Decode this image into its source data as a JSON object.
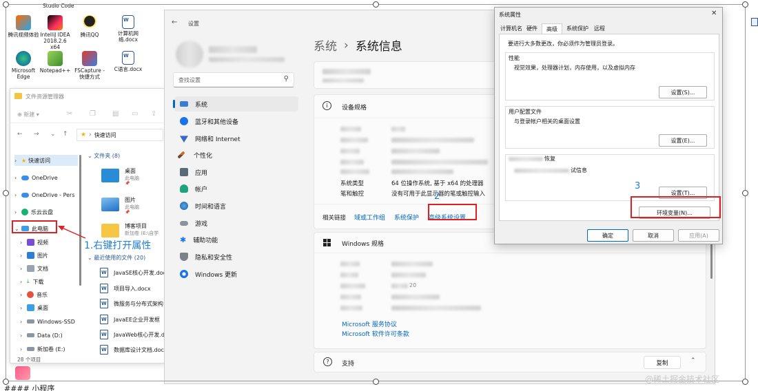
{
  "desktop": {
    "top_label": "Studio Code",
    "icons": [
      {
        "label": "腾讯视频体验"
      },
      {
        "label": "IntelliJ IDEA 2018.2.6 x64"
      },
      {
        "label": "腾讯QQ"
      },
      {
        "label": "计算机网络.docx"
      },
      {
        "label": "Microsoft Edge"
      },
      {
        "label": "Notepad++"
      },
      {
        "label": "FSCapture - 快捷方式"
      },
      {
        "label": "C语言.docx"
      }
    ],
    "bottom_label": "#### 小程序"
  },
  "explorer": {
    "title": "文件资源管理器",
    "new_label": "新建",
    "address": "快速访问",
    "tree": [
      "快速访问",
      "OneDrive",
      "OneDrive - Pers",
      "乐云云盘",
      "此电脑",
      "视频",
      "图片",
      "文档",
      "下载",
      "音乐",
      "桌面",
      "Windows-SSD",
      "Data (D:)",
      "新加卷 (E:)"
    ],
    "folders_header": "文件夹 (8)",
    "folders": [
      {
        "name": "桌面",
        "sub": "此电脑"
      },
      {
        "name": "图片",
        "sub": "此电脑"
      },
      {
        "name": "博客项目",
        "sub": "新加卷 (E:\\自学"
      }
    ],
    "recent_header": "最近使用的文件 (20)",
    "recent": [
      "JavaSE核心开发.doc",
      "项目导入.docx",
      "微服务与分布式架构",
      "JavaEE企业开发框",
      "JavaWeb核心开发.d",
      "数据库设计文档.doc"
    ],
    "status": "28 个项目"
  },
  "settings": {
    "title": "设置",
    "search_placeholder": "查找设置",
    "breadcrumb_parent": "系统",
    "breadcrumb_sep": "›",
    "breadcrumb_current": "系统信息",
    "nav": [
      "系统",
      "蓝牙和其他设备",
      "网络和 Internet",
      "个性化",
      "应用",
      "帐户",
      "时间和语言",
      "游戏",
      "辅助功能",
      "隐私和安全性",
      "Windows 更新"
    ],
    "device_specs_title": "设备规格",
    "system_type_label": "系统类型",
    "system_type_value": "64 位操作系统, 基于 x64 的处理器",
    "pen_label": "笔和触控",
    "pen_value": "没有可用于此显示器的笔或触控输入",
    "related_label": "相关链接",
    "related_links": [
      "域或工作组",
      "系统保护",
      "高级系统设置"
    ],
    "windows_specs_title": "Windows 规格",
    "version_fragment": "20",
    "ms_links": [
      "Microsoft 服务协议",
      "Microsoft 软件许可条款"
    ],
    "support_title": "支持",
    "copy_label": "复制"
  },
  "dialog": {
    "title": "系统属性",
    "tabs": [
      "计算机名",
      "硬件",
      "高级",
      "系统保护",
      "远程"
    ],
    "admin_note": "要进行大多数更改，你必须作为管理员登录。",
    "perf_title": "性能",
    "perf_desc": "视觉效果，处理器计划，内存使用，以及虚拟内存",
    "perf_btn": "设置(S)...",
    "profile_title": "用户配置文件",
    "profile_desc": "与登录帐户相关的桌面设置",
    "profile_btn": "设置(E)...",
    "startup_title_fragment": "恢复",
    "startup_desc_fragment": "试信息",
    "startup_btn": "设置(T)...",
    "env_btn": "环境变量(N)...",
    "ok": "确定",
    "cancel": "取消",
    "apply": "应用(A)"
  },
  "annotations": {
    "step1": "1.右键打开属性",
    "step2": "2",
    "step3": "3"
  },
  "watermark": "@稀土掘金技术社区",
  "colors": {
    "accent": "#0067c0",
    "annotation": "#1e7fd8",
    "highlight": "#e02020"
  }
}
